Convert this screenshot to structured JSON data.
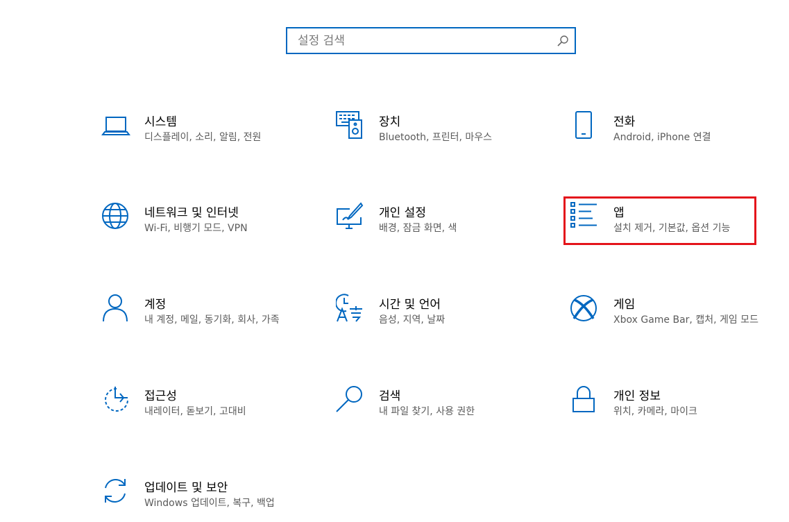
{
  "search": {
    "placeholder": "설정 검색",
    "icon": "search-icon"
  },
  "accent_color": "#0067c0",
  "highlight_color": "#e4141b",
  "tiles": [
    {
      "title": "시스템",
      "desc": "디스플레이, 소리, 알림, 전원",
      "icon": "laptop-icon"
    },
    {
      "title": "장치",
      "desc": "Bluetooth, 프린터, 마우스",
      "icon": "devices-icon"
    },
    {
      "title": "전화",
      "desc": "Android, iPhone 연결",
      "icon": "phone-icon"
    },
    {
      "title": "네트워크 및 인터넷",
      "desc": "Wi-Fi, 비행기 모드, VPN",
      "icon": "globe-icon"
    },
    {
      "title": "개인 설정",
      "desc": "배경, 잠금 화면, 색",
      "icon": "personalization-icon"
    },
    {
      "title": "앱",
      "desc": "설치 제거, 기본값, 옵션 기능",
      "icon": "apps-list-icon"
    },
    {
      "title": "계정",
      "desc": "내 계정, 메일, 동기화, 회사, 가족",
      "icon": "person-icon"
    },
    {
      "title": "시간 및 언어",
      "desc": "음성, 지역, 날짜",
      "icon": "time-language-icon"
    },
    {
      "title": "게임",
      "desc": "Xbox Game Bar, 캡처, 게임 모드",
      "icon": "xbox-icon"
    },
    {
      "title": "접근성",
      "desc": "내레이터, 돋보기, 고대비",
      "icon": "accessibility-icon"
    },
    {
      "title": "검색",
      "desc": "내 파일 찾기, 사용 권한",
      "icon": "search-magnifier-icon"
    },
    {
      "title": "개인 정보",
      "desc": "위치, 카메라, 마이크",
      "icon": "lock-icon"
    },
    {
      "title": "업데이트 및 보안",
      "desc": "Windows 업데이트, 복구, 백업",
      "icon": "update-icon"
    }
  ]
}
